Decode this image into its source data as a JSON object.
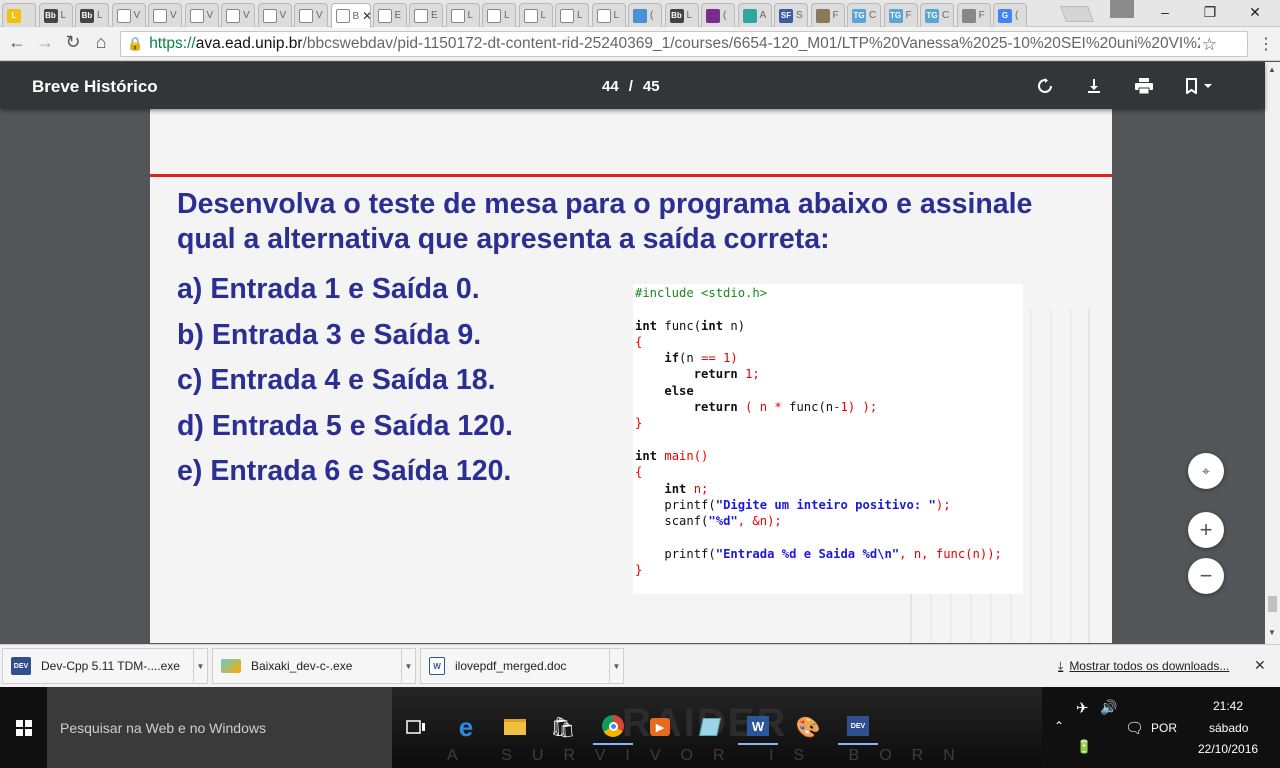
{
  "browser": {
    "tabs": [
      {
        "favicon": "yellow-icon",
        "color": "#f4c20d",
        "label": "L"
      },
      {
        "favicon": "bb-icon",
        "color": "#444444",
        "label": "Bb",
        "text": "L"
      },
      {
        "favicon": "bb-icon",
        "color": "#444444",
        "label": "Bb",
        "text": "L"
      },
      {
        "favicon": "document-icon",
        "color": "#ffffff",
        "text": "V"
      },
      {
        "favicon": "document-icon",
        "color": "#ffffff",
        "text": "V"
      },
      {
        "favicon": "document-icon",
        "color": "#ffffff",
        "text": "V"
      },
      {
        "favicon": "document-icon",
        "color": "#ffffff",
        "text": "V"
      },
      {
        "favicon": "document-icon",
        "color": "#ffffff",
        "text": "V"
      },
      {
        "favicon": "document-icon",
        "color": "#ffffff",
        "text": "V"
      },
      {
        "favicon": "document-icon",
        "color": "#ffffff",
        "text": "B",
        "active": true
      },
      {
        "favicon": "document-icon",
        "color": "#ffffff",
        "text": "E"
      },
      {
        "favicon": "document-icon",
        "color": "#ffffff",
        "text": "E"
      },
      {
        "favicon": "document-icon",
        "color": "#ffffff",
        "text": "L"
      },
      {
        "favicon": "document-icon",
        "color": "#ffffff",
        "text": "L"
      },
      {
        "favicon": "document-icon",
        "color": "#ffffff",
        "text": "L"
      },
      {
        "favicon": "document-icon",
        "color": "#ffffff",
        "text": "L"
      },
      {
        "favicon": "document-icon",
        "color": "#ffffff",
        "text": "L"
      },
      {
        "favicon": "blue-icon",
        "color": "#4a90d9",
        "text": "("
      },
      {
        "favicon": "bb-icon",
        "color": "#444444",
        "label": "Bb",
        "text": "L"
      },
      {
        "favicon": "mail-icon",
        "color": "#7b2c8a",
        "text": "("
      },
      {
        "favicon": "game-icon",
        "color": "#2aa8a0",
        "text": "A"
      },
      {
        "favicon": "sf-icon",
        "color": "#3b5ba5",
        "label": "SF",
        "text": "S"
      },
      {
        "favicon": "stripe-icon",
        "color": "#8a7a5a",
        "text": "F"
      },
      {
        "favicon": "tg-icon",
        "color": "#5aa5d8",
        "label": "TG",
        "text": "C"
      },
      {
        "favicon": "tg-icon",
        "color": "#5aa5d8",
        "label": "TG",
        "text": "F"
      },
      {
        "favicon": "tg-icon",
        "color": "#5aa5d8",
        "label": "TG",
        "text": "C"
      },
      {
        "favicon": "puzzle-icon",
        "color": "#888888",
        "text": "F"
      },
      {
        "favicon": "google-icon",
        "color": "#4285f4",
        "label": "G",
        "text": "("
      }
    ],
    "active_tab_text": "B",
    "url_scheme": "https://",
    "url_host": "ava.ead.unip.br",
    "url_path": "/bbcswebdav/pid-1150172-dt-content-rid-25240369_1/courses/6654-120_M01/LTP%20Vanessa%2025-10%20SEI%20uni%20VI%2"
  },
  "viewer": {
    "title": "Breve Histórico",
    "page_current": "44",
    "page_sep": "/",
    "page_total": "45"
  },
  "slide": {
    "question": "Desenvolva o teste de mesa para o programa abaixo e assinale qual a alternativa que apresenta a saída correta:",
    "options": [
      {
        "letter": "a)",
        "text": "Entrada 1 e Saída 0."
      },
      {
        "letter": "b)",
        "text": "Entrada 3 e Saída 9."
      },
      {
        "letter": "c)",
        "text": "Entrada 4 e Saída 18."
      },
      {
        "letter": "d)",
        "text": "Entrada 5 e Saída 120."
      },
      {
        "letter": "e)",
        "text": "Entrada 6 e Saída 120."
      }
    ],
    "code": {
      "include": "#include <stdio.h>",
      "func_sig_kw": "int",
      "func_sig_name": " func(",
      "func_sig_kw2": "int",
      "func_sig_end": " n)",
      "brace_open": "{",
      "brace_close": "}",
      "if_kw": "if",
      "if_cond_a": "(n ",
      "if_cond_b": "== 1)",
      "ret_kw": "return",
      "ret_one": " 1;",
      "else_kw": "else",
      "ret2_a": " ( n * ",
      "ret2_b": "func(n",
      "ret2_c": "-1) );",
      "main_kw": "int",
      "main_name": " main()",
      "decl_kw": "int",
      "decl_rest": " n;",
      "printf1_a": "printf(",
      "printf1_str": "\"Digite um inteiro positivo: \"",
      "printf1_end": ");",
      "scanf_a": "scanf(",
      "scanf_str": "\"%d\"",
      "scanf_end": ", &n);",
      "printf2_a": "printf(",
      "printf2_str": "\"Entrada %d e Saida %d\\n\"",
      "printf2_end": ", n, func(n));"
    }
  },
  "downloads": {
    "items": [
      {
        "icon": "devcpp-icon",
        "label": "Dev-Cpp 5.11 TDM-....exe"
      },
      {
        "icon": "installer-icon",
        "label": "Baixaki_dev-c-.exe"
      },
      {
        "icon": "word-doc-icon",
        "label": "ilovepdf_merged.doc"
      }
    ],
    "show_all": "Mostrar todos os downloads..."
  },
  "taskbar": {
    "search_placeholder": "Pesquisar na Web e no Windows",
    "wallpaper_title": "RAIDER",
    "wallpaper_sub": "A SURVIVOR IS BORN",
    "language": "POR",
    "time": "21:42",
    "day": "sábado",
    "date": "22/10/2016"
  }
}
